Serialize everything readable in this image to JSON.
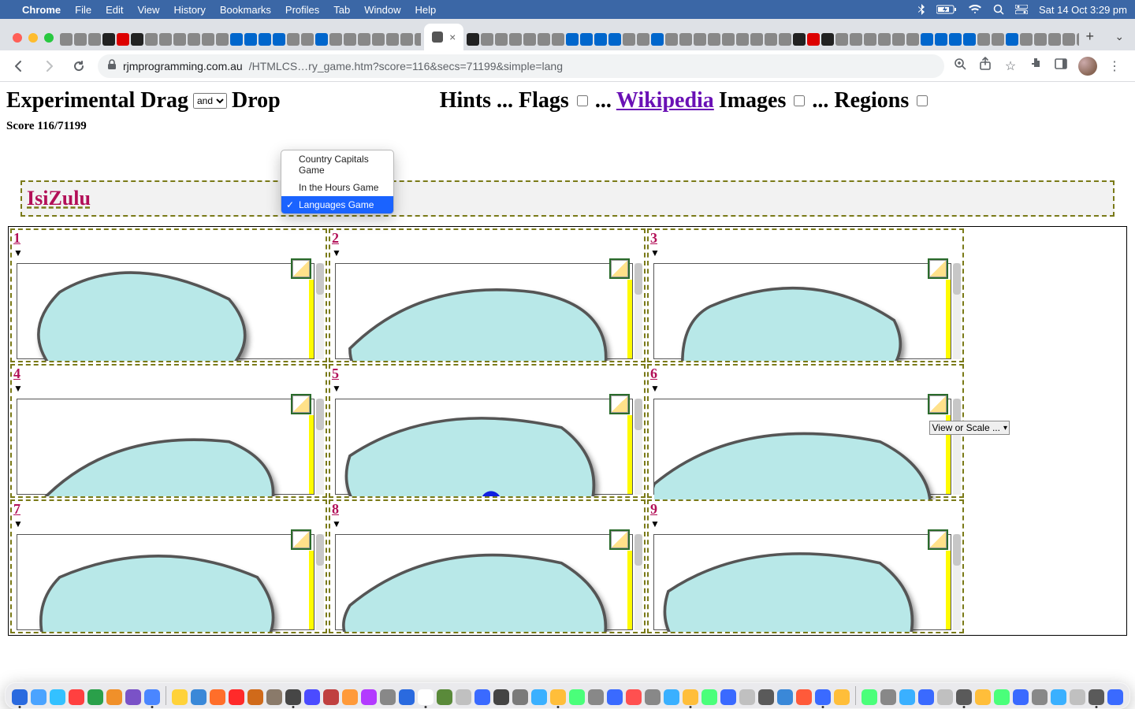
{
  "menubar": {
    "app": "Chrome",
    "items": [
      "File",
      "Edit",
      "View",
      "History",
      "Bookmarks",
      "Profiles",
      "Tab",
      "Window",
      "Help"
    ],
    "clock": "Sat 14 Oct  3:29 pm"
  },
  "browser": {
    "active_tab_close": "×",
    "url_domain": "rjmprogramming.com.au",
    "url_path": "/HTMLCS…ry_game.htm?score=116&secs=71199&simple=lang",
    "add_tab": "+",
    "tab_dropdown": "⌄"
  },
  "dropdown": {
    "options": [
      "Country Capitals Game",
      "In the Hours Game",
      "Languages Game"
    ],
    "selected_index": 2
  },
  "page_title": {
    "p1": "Experimental Drag",
    "select_value": "and",
    "p2": "Drop",
    "p3": "Hints ... Flags",
    "dots1": "...",
    "wikipedia": "Wikipedia",
    "p4": "Images",
    "dots2": "... Regions"
  },
  "score_line": "Score 116/71199",
  "drag_band_word": "IsiZulu",
  "cells": [
    {
      "n": "1"
    },
    {
      "n": "2"
    },
    {
      "n": "3"
    },
    {
      "n": "4"
    },
    {
      "n": "5"
    },
    {
      "n": "6"
    },
    {
      "n": "7"
    },
    {
      "n": "8"
    },
    {
      "n": "9"
    }
  ],
  "cell6_overlay": "View or Scale ...",
  "dock_colors": [
    "#2a6adf",
    "#4aa3ff",
    "#33c1ff",
    "#ff4040",
    "#2aa04a",
    "#f0902a",
    "#7a52c7",
    "#4a86ff",
    "#ffd23a",
    "#3a88d8",
    "#ff6e2a",
    "#ff2a2a",
    "#d06a1a",
    "#8a7a6a",
    "#464646",
    "#4b4bff",
    "#c04040",
    "#ff9a3a",
    "#b33aff",
    "#888888",
    "#2a6adf",
    "#ffffff",
    "#5a8a3a",
    "#c0c0c0",
    "#3a6aff",
    "#444444",
    "#7a7a7a",
    "#3ab0ff",
    "#ffbe3a",
    "#4aff7a",
    "#888888",
    "#3a6aff",
    "#ff5050",
    "#888888",
    "#3ab0ff",
    "#ffbe3a",
    "#4aff7a",
    "#3a6aff",
    "#c0c0c0",
    "#5a5a5a",
    "#3a88d8",
    "#ff5a3a",
    "#3a6aff",
    "#ffbe3a",
    "#4aff7a",
    "#888888",
    "#3ab0ff",
    "#3a6aff",
    "#c0c0c0",
    "#5a5a5a",
    "#ffbe3a",
    "#4aff7a",
    "#3a6aff",
    "#888888",
    "#3ab0ff",
    "#c0c0c0",
    "#5a5a5a",
    "#3a6aff"
  ]
}
